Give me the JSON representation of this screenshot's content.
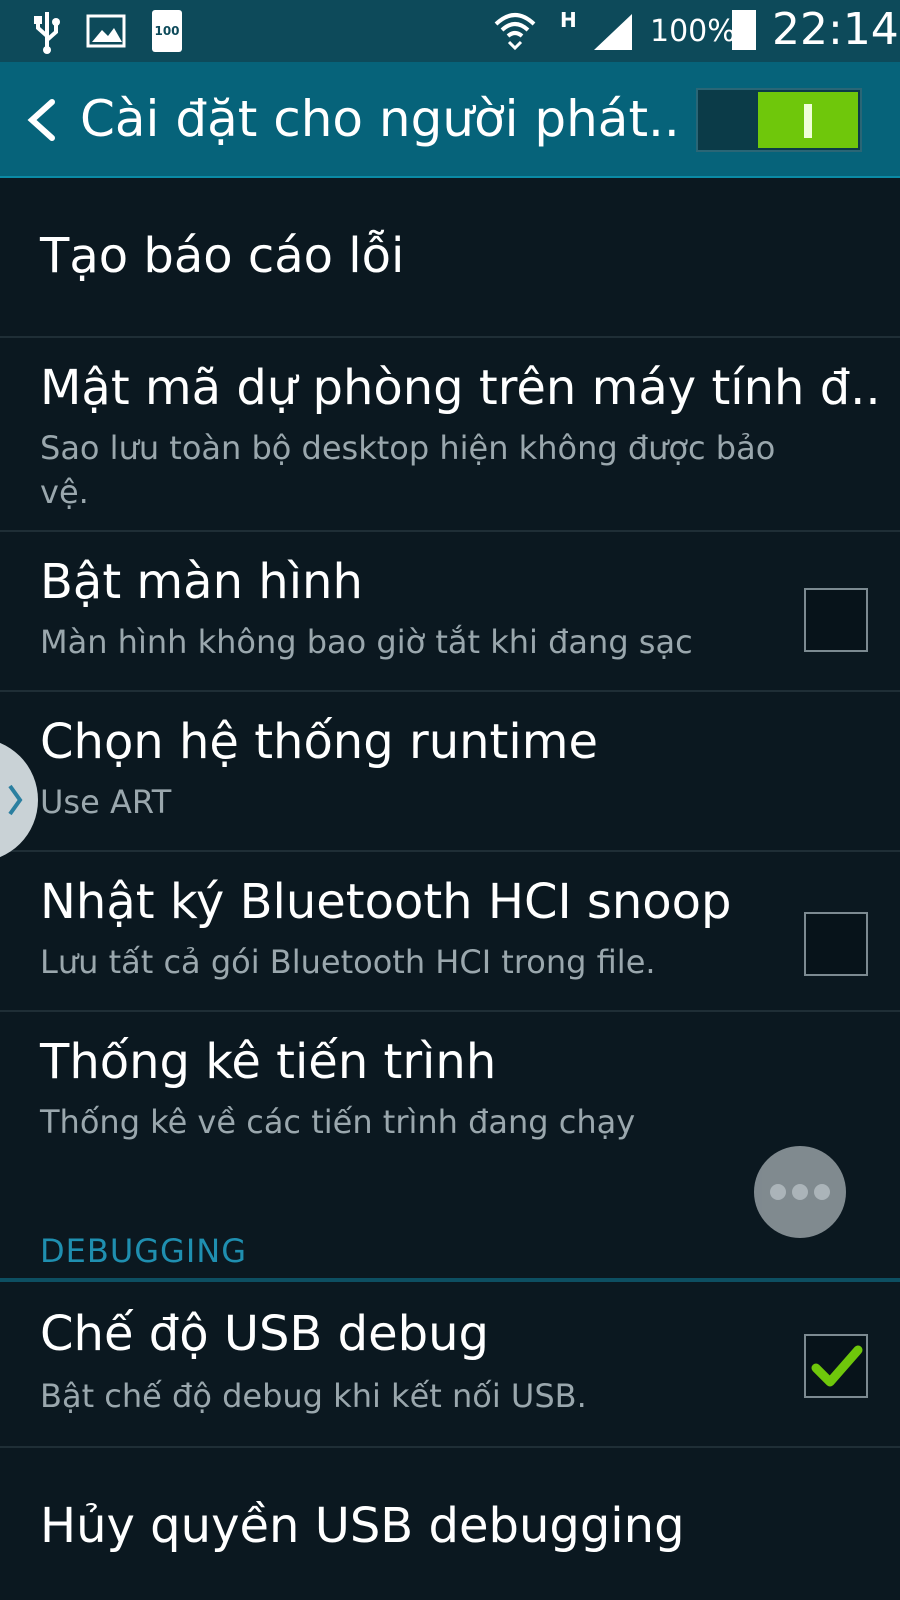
{
  "status_bar": {
    "icons": [
      "usb-icon",
      "image-icon",
      "battery-saver-icon",
      "wifi-icon",
      "network-h-icon",
      "signal-icon",
      "battery-icon"
    ],
    "battery_small_label": "100",
    "network_type": "H",
    "battery_percent": "100%",
    "time": "22:14"
  },
  "header": {
    "title": "Cài đặt cho người phát..",
    "master_toggle_on": true
  },
  "items": [
    {
      "label": "Tạo báo cáo lỗi"
    },
    {
      "label": "Mật mã dự phòng trên máy tính đ..",
      "summary": "Sao lưu toàn bộ desktop hiện không được bảo vệ."
    },
    {
      "label": "Bật màn hình",
      "summary": "Màn hình không bao giờ tắt khi đang sạc",
      "checked": false
    },
    {
      "label": "Chọn hệ thống runtime",
      "summary": "Use ART"
    },
    {
      "label": "Nhật ký Bluetooth HCI snoop",
      "summary": "Lưu tất cả gói Bluetooth HCI trong file.",
      "checked": false
    },
    {
      "label": "Thống kê tiến trình",
      "summary": "Thống kê về các tiến trình đang chạy"
    }
  ],
  "debugging": {
    "section_title": "DEBUGGING",
    "items": [
      {
        "label": "Chế độ USB debug",
        "summary": "Bật chế độ debug khi kết nối USB.",
        "checked": true
      },
      {
        "label": "Hủy quyền USB debugging"
      }
    ]
  },
  "colors": {
    "status_bar": "#0d4a5a",
    "action_bar": "#06637a",
    "background": "#0b1820",
    "accent_green": "#6fc70b",
    "section_header": "#1f8fb0"
  }
}
